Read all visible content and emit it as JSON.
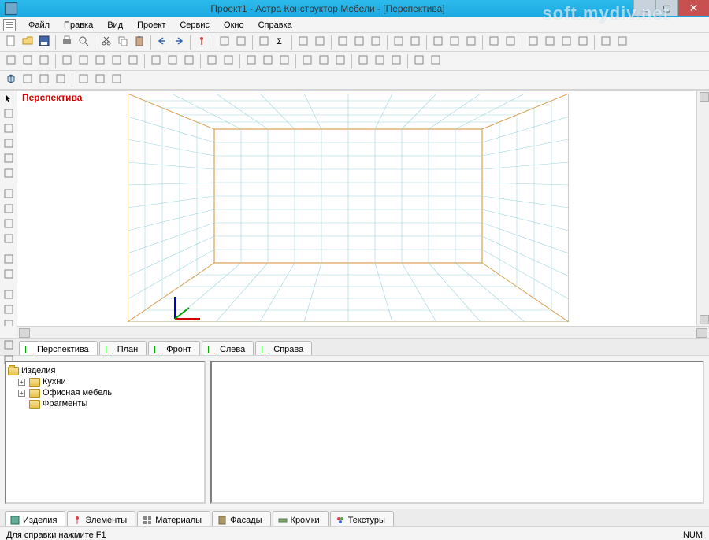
{
  "window": {
    "title": "Проект1 - Астра Конструктор Мебели - [Перспектива]",
    "watermark": "soft.mydiv.net",
    "buttons": {
      "min": "_",
      "max": "▢",
      "close": "✕"
    }
  },
  "menu": {
    "items": [
      "Файл",
      "Правка",
      "Вид",
      "Проект",
      "Сервис",
      "Окно",
      "Справка"
    ]
  },
  "viewport": {
    "label": "Перспектива"
  },
  "view_tabs": {
    "items": [
      "Перспектива",
      "План",
      "Фронт",
      "Слева",
      "Справа"
    ],
    "active": 0
  },
  "tree": {
    "root": "Изделия",
    "children": [
      {
        "label": "Кухни",
        "expandable": true
      },
      {
        "label": "Офисная мебель",
        "expandable": true
      },
      {
        "label": "Фрагменты",
        "expandable": false
      }
    ]
  },
  "bottom_tabs": {
    "items": [
      "Изделия",
      "Элементы",
      "Материалы",
      "Фасады",
      "Кромки",
      "Текстуры"
    ],
    "active": 0
  },
  "status": {
    "help": "Для справки нажмите F1",
    "indicator": "NUM"
  },
  "toolbar_icons_row1": [
    "new",
    "open",
    "save",
    "sep",
    "print",
    "preview",
    "sep",
    "cut",
    "copy",
    "paste",
    "sep",
    "undo",
    "redo",
    "sep",
    "pin",
    "sep",
    "grid1",
    "grid2",
    "sep",
    "measure",
    "sigma",
    "sep",
    "box1",
    "box2",
    "sep",
    "zoomin",
    "zoomout",
    "zoomfit",
    "sep",
    "pan",
    "target",
    "sep",
    "win1",
    "win2",
    "win3",
    "sep",
    "mat1",
    "mat2",
    "sep",
    "tool1",
    "tool2",
    "tool3",
    "tool4",
    "sep",
    "misc1",
    "misc2"
  ],
  "toolbar_icons_row2": [
    "align1",
    "align2",
    "align3",
    "sep",
    "distr1",
    "distr2",
    "distr3",
    "distr4",
    "distr5",
    "sep",
    "flip1",
    "flip2",
    "rot1",
    "sep",
    "arr1",
    "arr2",
    "sep",
    "layer1",
    "layer2",
    "layer3",
    "sep",
    "snap1",
    "snap2",
    "snap3",
    "sep",
    "grp1",
    "grp2",
    "grp3",
    "sep",
    "sel1",
    "sel2"
  ],
  "toolbar_icons_row3": [
    "cube",
    "cyl",
    "cone",
    "torus",
    "sep",
    "panel1",
    "panel2",
    "panel3"
  ],
  "side_icons": [
    "pointer",
    "line",
    "rect",
    "rectfill",
    "scissors",
    "cross",
    "sep",
    "dim1",
    "dim2",
    "dim3",
    "dim4",
    "sep",
    "rot",
    "rot2",
    "sep",
    "m1",
    "m2",
    "m3",
    "sep",
    "m4",
    "m5"
  ],
  "colors": {
    "title_bg": "#1ba8e0",
    "accent_label": "#d00000",
    "grid": "#7ec8d8",
    "room_outline": "#d8a050"
  }
}
